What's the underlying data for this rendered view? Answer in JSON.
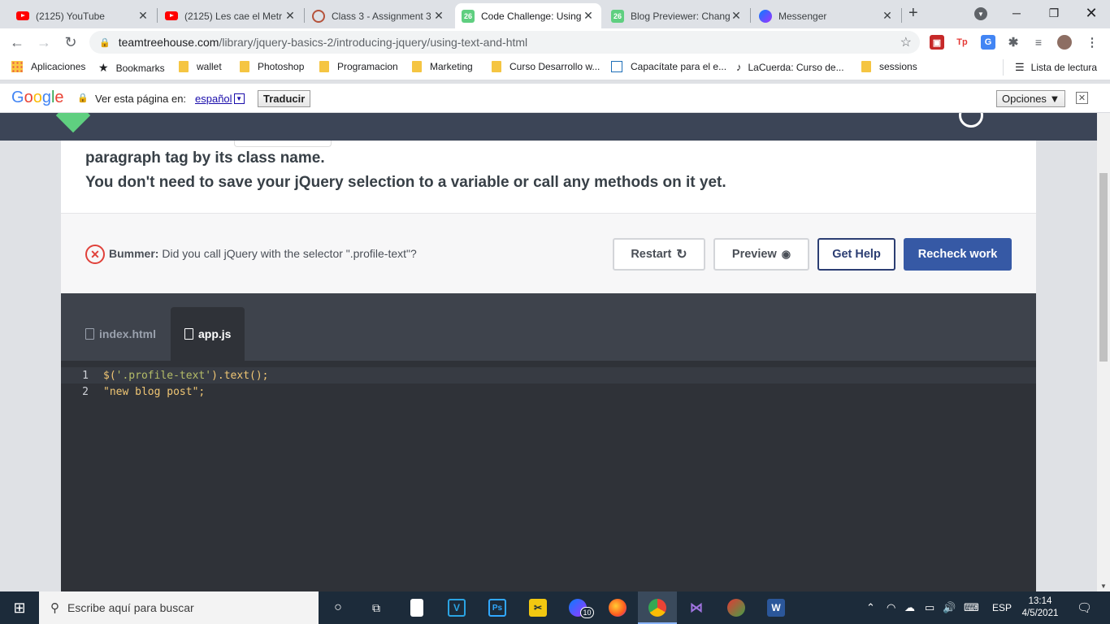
{
  "browser": {
    "tabs": [
      {
        "title": "(2125) YouTube",
        "favicon": "youtube-icon",
        "active": false
      },
      {
        "title": "(2125) Les cae el Metr",
        "favicon": "youtube-icon",
        "active": false
      },
      {
        "title": "Class 3 - Assignment 3",
        "favicon": "assignment-icon",
        "active": false
      },
      {
        "title": "Code Challenge: Using",
        "favicon": "treehouse-icon",
        "active": true
      },
      {
        "title": "Blog Previewer: Chang",
        "favicon": "treehouse-icon",
        "active": false
      },
      {
        "title": "Messenger",
        "favicon": "messenger-icon",
        "active": false
      }
    ],
    "new_tab": "+",
    "url_host": "teamtreehouse.com",
    "url_path": "/library/jquery-basics-2/introducing-jquery/using-text-and-html",
    "bookmarks": [
      {
        "label": "Aplicaciones",
        "icon": "apps-grid-icon"
      },
      {
        "label": "Bookmarks",
        "icon": "star-icon"
      },
      {
        "label": "wallet",
        "icon": "folder-icon"
      },
      {
        "label": "Photoshop",
        "icon": "folder-icon"
      },
      {
        "label": "Programacion",
        "icon": "folder-icon"
      },
      {
        "label": "Marketing",
        "icon": "folder-icon"
      },
      {
        "label": "Curso Desarrollo w...",
        "icon": "folder-icon"
      },
      {
        "label": "Capacítate para el e...",
        "icon": "page-icon"
      },
      {
        "label": "LaCuerda: Curso de...",
        "icon": "guitar-icon"
      },
      {
        "label": "sessions",
        "icon": "folder-icon"
      }
    ],
    "reading_list": "Lista de lectura"
  },
  "translate_bar": {
    "prompt": "Ver esta página en:",
    "language": "español",
    "translate_button": "Traducir",
    "options_button": "Opciones ▼"
  },
  "challenge": {
    "line1": "paragraph tag by its class name.",
    "line2": "You don't need to save your jQuery selection to a variable or call any methods on it yet.",
    "status_label": "Bummer:",
    "status_text": "Did you call jQuery with the selector \".profile-text\"?",
    "restart": "Restart",
    "preview": "Preview",
    "get_help": "Get Help",
    "recheck": "Recheck work"
  },
  "editor": {
    "files": [
      "index.html",
      "app.js"
    ],
    "active_file": "app.js",
    "lines": [
      {
        "n": "1",
        "text": "$('.profile-text').text();"
      },
      {
        "n": "2",
        "text": "\"new blog post\";"
      }
    ]
  },
  "taskbar": {
    "search_placeholder": "Escribe aquí para buscar",
    "language": "ESP",
    "time": "13:14",
    "date": "4/5/2021",
    "messenger_badge": "10"
  },
  "colors": {
    "recheck_bg": "#3659a5",
    "get_help_border": "#2c3e73",
    "error_red": "#e0413a",
    "editor_bg": "#2f3238",
    "taskbar_bg": "#1c2b3a"
  }
}
